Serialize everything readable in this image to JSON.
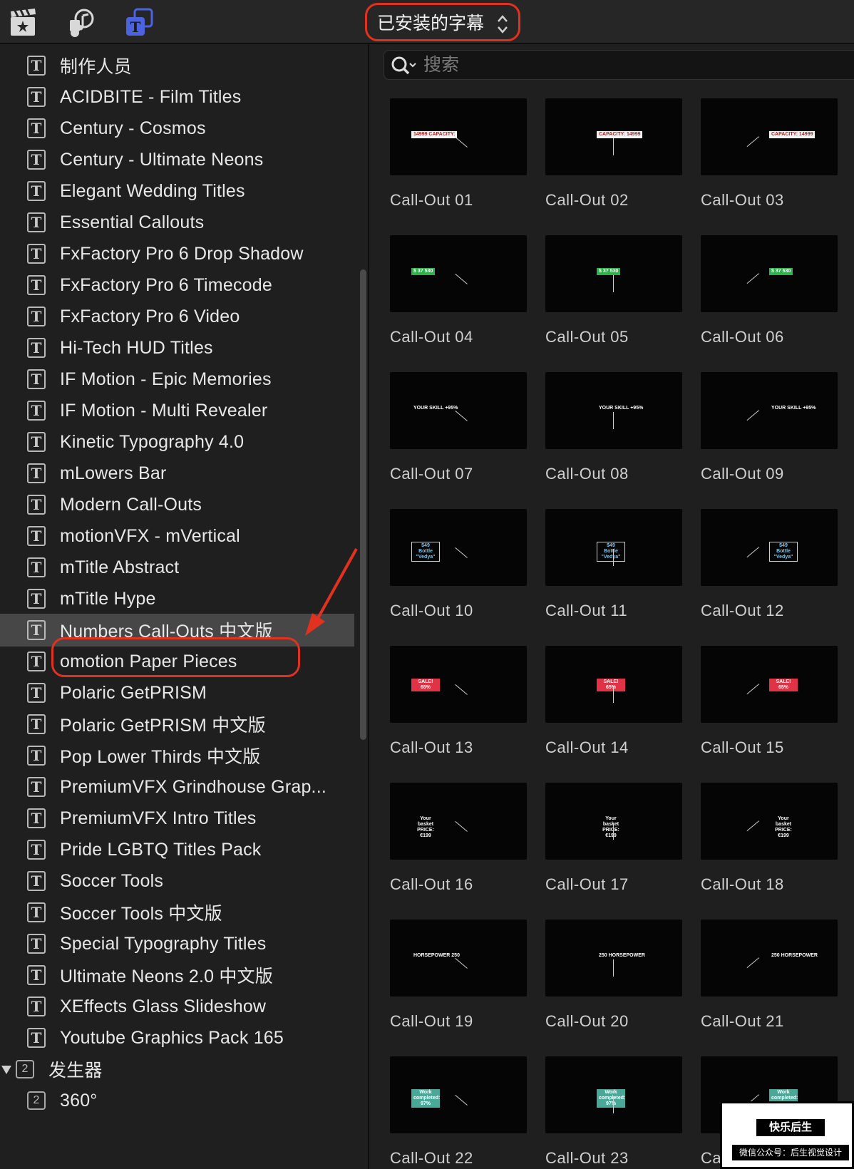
{
  "toolbar": {
    "source_menu_label": "已安装的字幕",
    "icons": [
      "clapper-icon",
      "music-icon",
      "titles-icon"
    ]
  },
  "sidebar": {
    "items": [
      "制作人员",
      "ACIDBITE - Film Titles",
      "Century - Cosmos",
      "Century - Ultimate Neons",
      "Elegant Wedding Titles",
      "Essential Callouts",
      "FxFactory Pro 6 Drop Shadow",
      "FxFactory Pro 6 Timecode",
      "FxFactory Pro 6 Video",
      "Hi-Tech HUD Titles",
      "IF Motion - Epic Memories",
      "IF Motion - Multi Revealer",
      "Kinetic Typography 4.0",
      "mLowers Bar",
      "Modern Call-Outs",
      "motionVFX - mVertical",
      "mTitle Abstract",
      "mTitle Hype",
      "Numbers Call-Outs 中文版",
      "omotion Paper Pieces",
      "Polaric GetPRISM",
      "Polaric GetPRISM 中文版",
      "Pop Lower Thirds 中文版",
      "PremiumVFX Grindhouse Grap...",
      "PremiumVFX Intro Titles",
      "Pride LGBTQ Titles Pack",
      "Soccer Tools",
      "Soccer Tools 中文版",
      "Special Typography Titles",
      "Ultimate Neons 2.0 中文版",
      "XEffects Glass Slideshow",
      "Youtube Graphics Pack 165"
    ],
    "selected_index": 18,
    "generators_group": {
      "badge": "2",
      "label": "发生器"
    },
    "generator_items": [
      {
        "badge": "2",
        "label": "360°"
      }
    ]
  },
  "search": {
    "placeholder": "搜索",
    "value": ""
  },
  "grid": {
    "tiles": [
      {
        "label": "Call-Out 01",
        "tag": "14999  CAPACITY:",
        "style": "white"
      },
      {
        "label": "Call-Out 02",
        "tag": "CAPACITY:  14999",
        "style": "white"
      },
      {
        "label": "Call-Out 03",
        "tag": "CAPACITY:  14999",
        "style": "white"
      },
      {
        "label": "Call-Out 04",
        "tag": "$ 37 530",
        "style": "green"
      },
      {
        "label": "Call-Out 05",
        "tag": "$ 37 530",
        "style": "green"
      },
      {
        "label": "Call-Out 06",
        "tag": "$ 37 530",
        "style": "green"
      },
      {
        "label": "Call-Out 07",
        "tag": "YOUR SKILL +95%",
        "style": "skill"
      },
      {
        "label": "Call-Out 08",
        "tag": "YOUR SKILL +95%",
        "style": "skill"
      },
      {
        "label": "Call-Out 09",
        "tag": "YOUR SKILL +95%",
        "style": "skill"
      },
      {
        "label": "Call-Out 10",
        "tag": "$49 Bottle \"Vedya\"",
        "style": "outline"
      },
      {
        "label": "Call-Out 11",
        "tag": "$49 Bottle \"Vedya\"",
        "style": "outline"
      },
      {
        "label": "Call-Out 12",
        "tag": "$49 Bottle \"Vedya\"",
        "style": "outline"
      },
      {
        "label": "Call-Out 13",
        "tag": "SALE! 65%",
        "style": "red"
      },
      {
        "label": "Call-Out 14",
        "tag": "SALE! 65%",
        "style": "red"
      },
      {
        "label": "Call-Out 15",
        "tag": "SALE! 65%",
        "style": "red"
      },
      {
        "label": "Call-Out 16",
        "tag": "Your basket  PRICE: €199",
        "style": "basket"
      },
      {
        "label": "Call-Out 17",
        "tag": "Your basket  PRICE: €199",
        "style": "basket"
      },
      {
        "label": "Call-Out 18",
        "tag": "Your basket  PRICE: €199",
        "style": "basket"
      },
      {
        "label": "Call-Out 19",
        "tag": "HORSEPOWER 250",
        "style": "horse"
      },
      {
        "label": "Call-Out 20",
        "tag": "250 HORSEPOWER",
        "style": "horse"
      },
      {
        "label": "Call-Out 21",
        "tag": "250 HORSEPOWER",
        "style": "horse"
      },
      {
        "label": "Call-Out 22",
        "tag": "Work completed: 97%",
        "style": "teal"
      },
      {
        "label": "Call-Out 23",
        "tag": "Work completed: 97%",
        "style": "teal"
      },
      {
        "label": "Call-Out 24",
        "tag": "Work completed: 97%",
        "style": "teal"
      }
    ]
  },
  "watermark": {
    "title": "快乐后生",
    "subtitle": "微信公众号：后生视觉设计"
  },
  "colors": {
    "accent_red": "#e2321f",
    "selected_row": "#474747",
    "titles_icon": "#4b63e0"
  }
}
